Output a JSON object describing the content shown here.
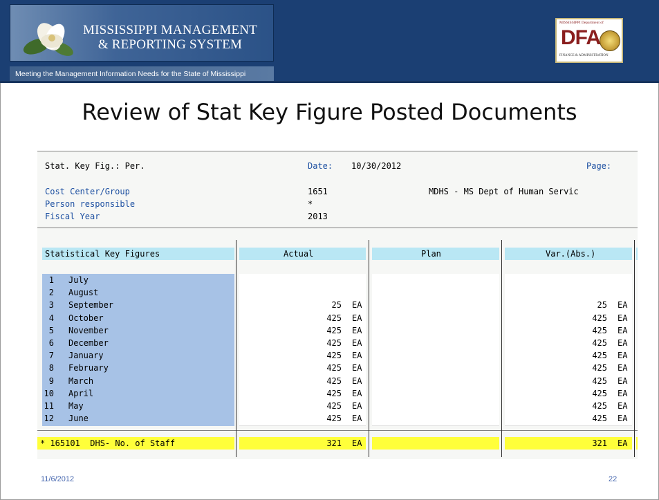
{
  "header": {
    "brand_line1": "MISSISSIPPI MANAGEMENT",
    "brand_line2": "& REPORTING SYSTEM",
    "tagline": "Meeting the Management Information Needs for the State of Mississippi",
    "dfa_small": "MISSISSIPPI Department of",
    "dfa_letters": "DFA",
    "dfa_sub": "FINANCE & ADMINISTRATION"
  },
  "slide": {
    "title": "Review of Stat Key Figure Posted Documents"
  },
  "report": {
    "name": "Stat. Key Fig.: Per.",
    "date_label": "Date:",
    "date_value": "10/30/2012",
    "page_label": "Page:",
    "fields": [
      {
        "label": "Cost Center/Group",
        "value": "1651",
        "desc": "MDHS - MS Dept of Human Servic"
      },
      {
        "label": "Person responsible",
        "value": "*"
      },
      {
        "label": "Fiscal Year",
        "value": "2013"
      }
    ],
    "columns": [
      "Statistical Key Figures",
      "Actual",
      "Plan",
      "Var.(Abs.)"
    ],
    "rows": [
      {
        "num": "1",
        "month": "July",
        "actual": "",
        "actual_unit": "",
        "var": "",
        "var_unit": ""
      },
      {
        "num": "2",
        "month": "August",
        "actual": "",
        "actual_unit": "",
        "var": "",
        "var_unit": ""
      },
      {
        "num": "3",
        "month": "September",
        "actual": "25",
        "actual_unit": "EA",
        "var": "25",
        "var_unit": "EA"
      },
      {
        "num": "4",
        "month": "October",
        "actual": "425",
        "actual_unit": "EA",
        "var": "425",
        "var_unit": "EA"
      },
      {
        "num": "5",
        "month": "November",
        "actual": "425",
        "actual_unit": "EA",
        "var": "425",
        "var_unit": "EA"
      },
      {
        "num": "6",
        "month": "December",
        "actual": "425",
        "actual_unit": "EA",
        "var": "425",
        "var_unit": "EA"
      },
      {
        "num": "7",
        "month": "January",
        "actual": "425",
        "actual_unit": "EA",
        "var": "425",
        "var_unit": "EA"
      },
      {
        "num": "8",
        "month": "February",
        "actual": "425",
        "actual_unit": "EA",
        "var": "425",
        "var_unit": "EA"
      },
      {
        "num": "9",
        "month": "March",
        "actual": "425",
        "actual_unit": "EA",
        "var": "425",
        "var_unit": "EA"
      },
      {
        "num": "10",
        "month": "April",
        "actual": "425",
        "actual_unit": "EA",
        "var": "425",
        "var_unit": "EA"
      },
      {
        "num": "11",
        "month": "May",
        "actual": "425",
        "actual_unit": "EA",
        "var": "425",
        "var_unit": "EA"
      },
      {
        "num": "12",
        "month": "June",
        "actual": "425",
        "actual_unit": "EA",
        "var": "425",
        "var_unit": "EA"
      }
    ],
    "total": {
      "label": "* 165101  DHS- No. of Staff",
      "actual": "321",
      "actual_unit": "EA",
      "var": "321",
      "var_unit": "EA"
    }
  },
  "footer": {
    "date": "11/6/2012",
    "page": "22"
  },
  "colors": {
    "header_bg": "#1b3f73",
    "column_header": "#b9e7f4",
    "row_label": "#a7c2e6",
    "total_row": "#ffff3a",
    "label_blue": "#1c4fa1"
  }
}
